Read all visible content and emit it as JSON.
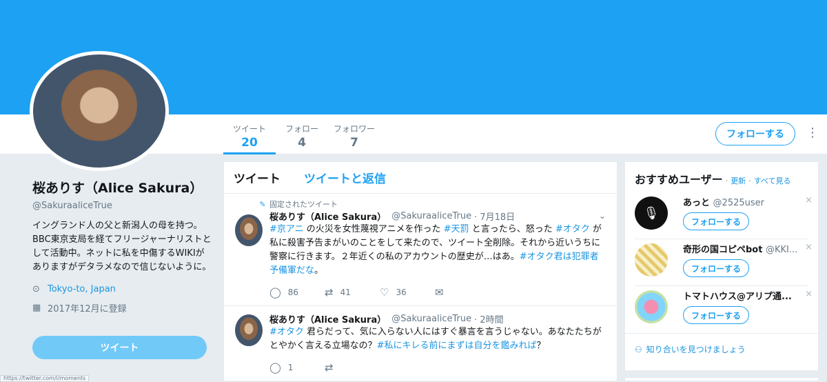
{
  "profile": {
    "name": "桜ありす（Alice Sakura）",
    "handle": "@SakuraaliceTrue",
    "bio": "イングランド人の父と新潟人の母を持つ。BBC東京支局を経てフリージャーナリストとして活動中。ネットに私を中傷するWIKIがありますがデタラメなので信じないように。",
    "location": "Tokyo-to, Japan",
    "joined": "2017年12月に登録",
    "tweet_button": "ツイート"
  },
  "stats": [
    {
      "label": "ツイート",
      "value": "20"
    },
    {
      "label": "フォロー",
      "value": "4"
    },
    {
      "label": "フォロワー",
      "value": "7"
    }
  ],
  "follow_button": "フォローする",
  "timeline": {
    "tabs": [
      "ツイート",
      "ツイートと返信"
    ],
    "pinned_label": "固定されたツイート",
    "tweets": [
      {
        "name": "桜ありす（Alice Sakura）",
        "handle": "@SakuraaliceTrue",
        "time": "· 7月18日",
        "segments": [
          {
            "t": "#京アニ",
            "tag": true
          },
          {
            "t": " の火災を女性蔑視アニメを作った ",
            "tag": false
          },
          {
            "t": "#天罰",
            "tag": true
          },
          {
            "t": " と言ったら、怒った ",
            "tag": false
          },
          {
            "t": "#オタク",
            "tag": true
          },
          {
            "t": " が私に殺害予告まがいのことをして来たので、ツイート全削除。それから近いうちに警察に行きます。２年近くの私のアカウントの歴史が…はあ。",
            "tag": false
          },
          {
            "t": "#オタク君は犯罪者予備軍だな",
            "tag": true
          },
          {
            "t": "。",
            "tag": false
          }
        ],
        "replies": "86",
        "retweets": "41",
        "likes": "36"
      },
      {
        "name": "桜ありす（Alice Sakura）",
        "handle": "@SakuraaliceTrue",
        "time": "· 2時間",
        "segments": [
          {
            "t": "#オタク",
            "tag": true
          },
          {
            "t": " 君らだって、気に入らない人にはすぐ暴言を言うじゃない。あなたたちがとやかく言える立場なの？",
            "tag": false
          },
          {
            "t": "#私にキレる前にまずは自分を鑑みれば",
            "tag": true
          },
          {
            "t": "？",
            "tag": false
          }
        ],
        "replies": "1",
        "retweets": "",
        "likes": ""
      }
    ]
  },
  "sidebar": {
    "title": "おすすめユーザー",
    "refresh": "更新",
    "view_all": "すべて見る",
    "sep": "·",
    "users": [
      {
        "name": "あっと",
        "handle": "@2525user",
        "button": "フォローする"
      },
      {
        "name": "奇形の国コピペbot",
        "handle": "@KKI...",
        "button": "フォローする"
      },
      {
        "name": "トマトハウス@アリプ通...",
        "handle": "",
        "button": "フォローする"
      }
    ],
    "find_friends": "知り合いを見つけましょう"
  },
  "status_url": "https://twitter.com/i/moments",
  "colors": {
    "accent": "#1da1f2",
    "background": "#e6ecf0"
  }
}
